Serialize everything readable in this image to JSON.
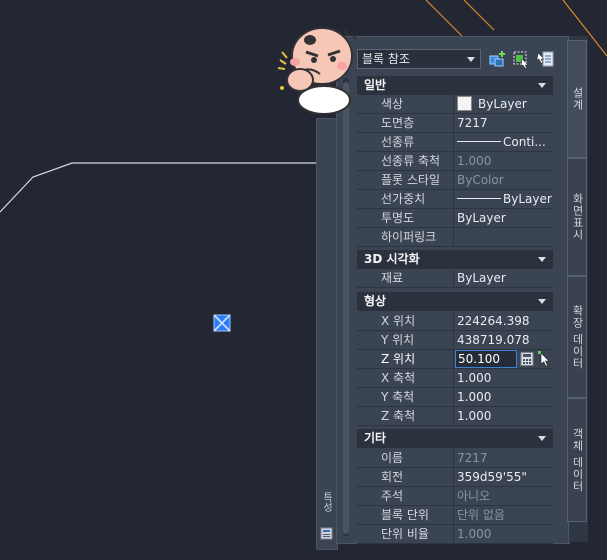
{
  "toolbar": {
    "object_type": "블록 참조",
    "buttons": [
      "toggle-pickadd-icon",
      "select-objects-icon",
      "quick-select-icon"
    ]
  },
  "tabs": [
    {
      "label": "설계"
    },
    {
      "label": "화면표시"
    },
    {
      "label": "확장 데이터"
    },
    {
      "label": "객체 데이터"
    }
  ],
  "strip": {
    "label": "특성"
  },
  "sections": {
    "general": {
      "title": "일반",
      "rows": [
        {
          "key": "색상",
          "value": "ByLayer"
        },
        {
          "key": "도면층",
          "value": "7217"
        },
        {
          "key": "선종류",
          "value": "Conti..."
        },
        {
          "key": "선종류 축척",
          "value": "1.000"
        },
        {
          "key": "플롯 스타일",
          "value": "ByColor"
        },
        {
          "key": "선가중치",
          "value": "ByLayer"
        },
        {
          "key": "투명도",
          "value": "ByLayer"
        },
        {
          "key": "하이퍼링크",
          "value": ""
        }
      ]
    },
    "viz3d": {
      "title": "3D 시각화",
      "rows": [
        {
          "key": "재료",
          "value": "ByLayer"
        }
      ]
    },
    "geometry": {
      "title": "형상",
      "rows": [
        {
          "key": "X 위치",
          "value": "224264.398"
        },
        {
          "key": "Y 위치",
          "value": "438719.078"
        },
        {
          "key": "Z 위치",
          "value": "50.100"
        },
        {
          "key": "X 축척",
          "value": "1.000"
        },
        {
          "key": "Y 축척",
          "value": "1.000"
        },
        {
          "key": "Z 축척",
          "value": "1.000"
        }
      ]
    },
    "misc": {
      "title": "기타",
      "rows": [
        {
          "key": "이름",
          "value": "7217"
        },
        {
          "key": "회전",
          "value": "359d59'55\""
        },
        {
          "key": "주석",
          "value": "아니오"
        },
        {
          "key": "블록 단위",
          "value": "단위 없음"
        },
        {
          "key": "단위 비율",
          "value": "1.000"
        }
      ]
    }
  },
  "colors": {
    "canvas": "#222733",
    "panel": "#3b4453",
    "section": "#2b313d",
    "grip": "#2f7cf6",
    "accent_line": "#d9892a"
  }
}
